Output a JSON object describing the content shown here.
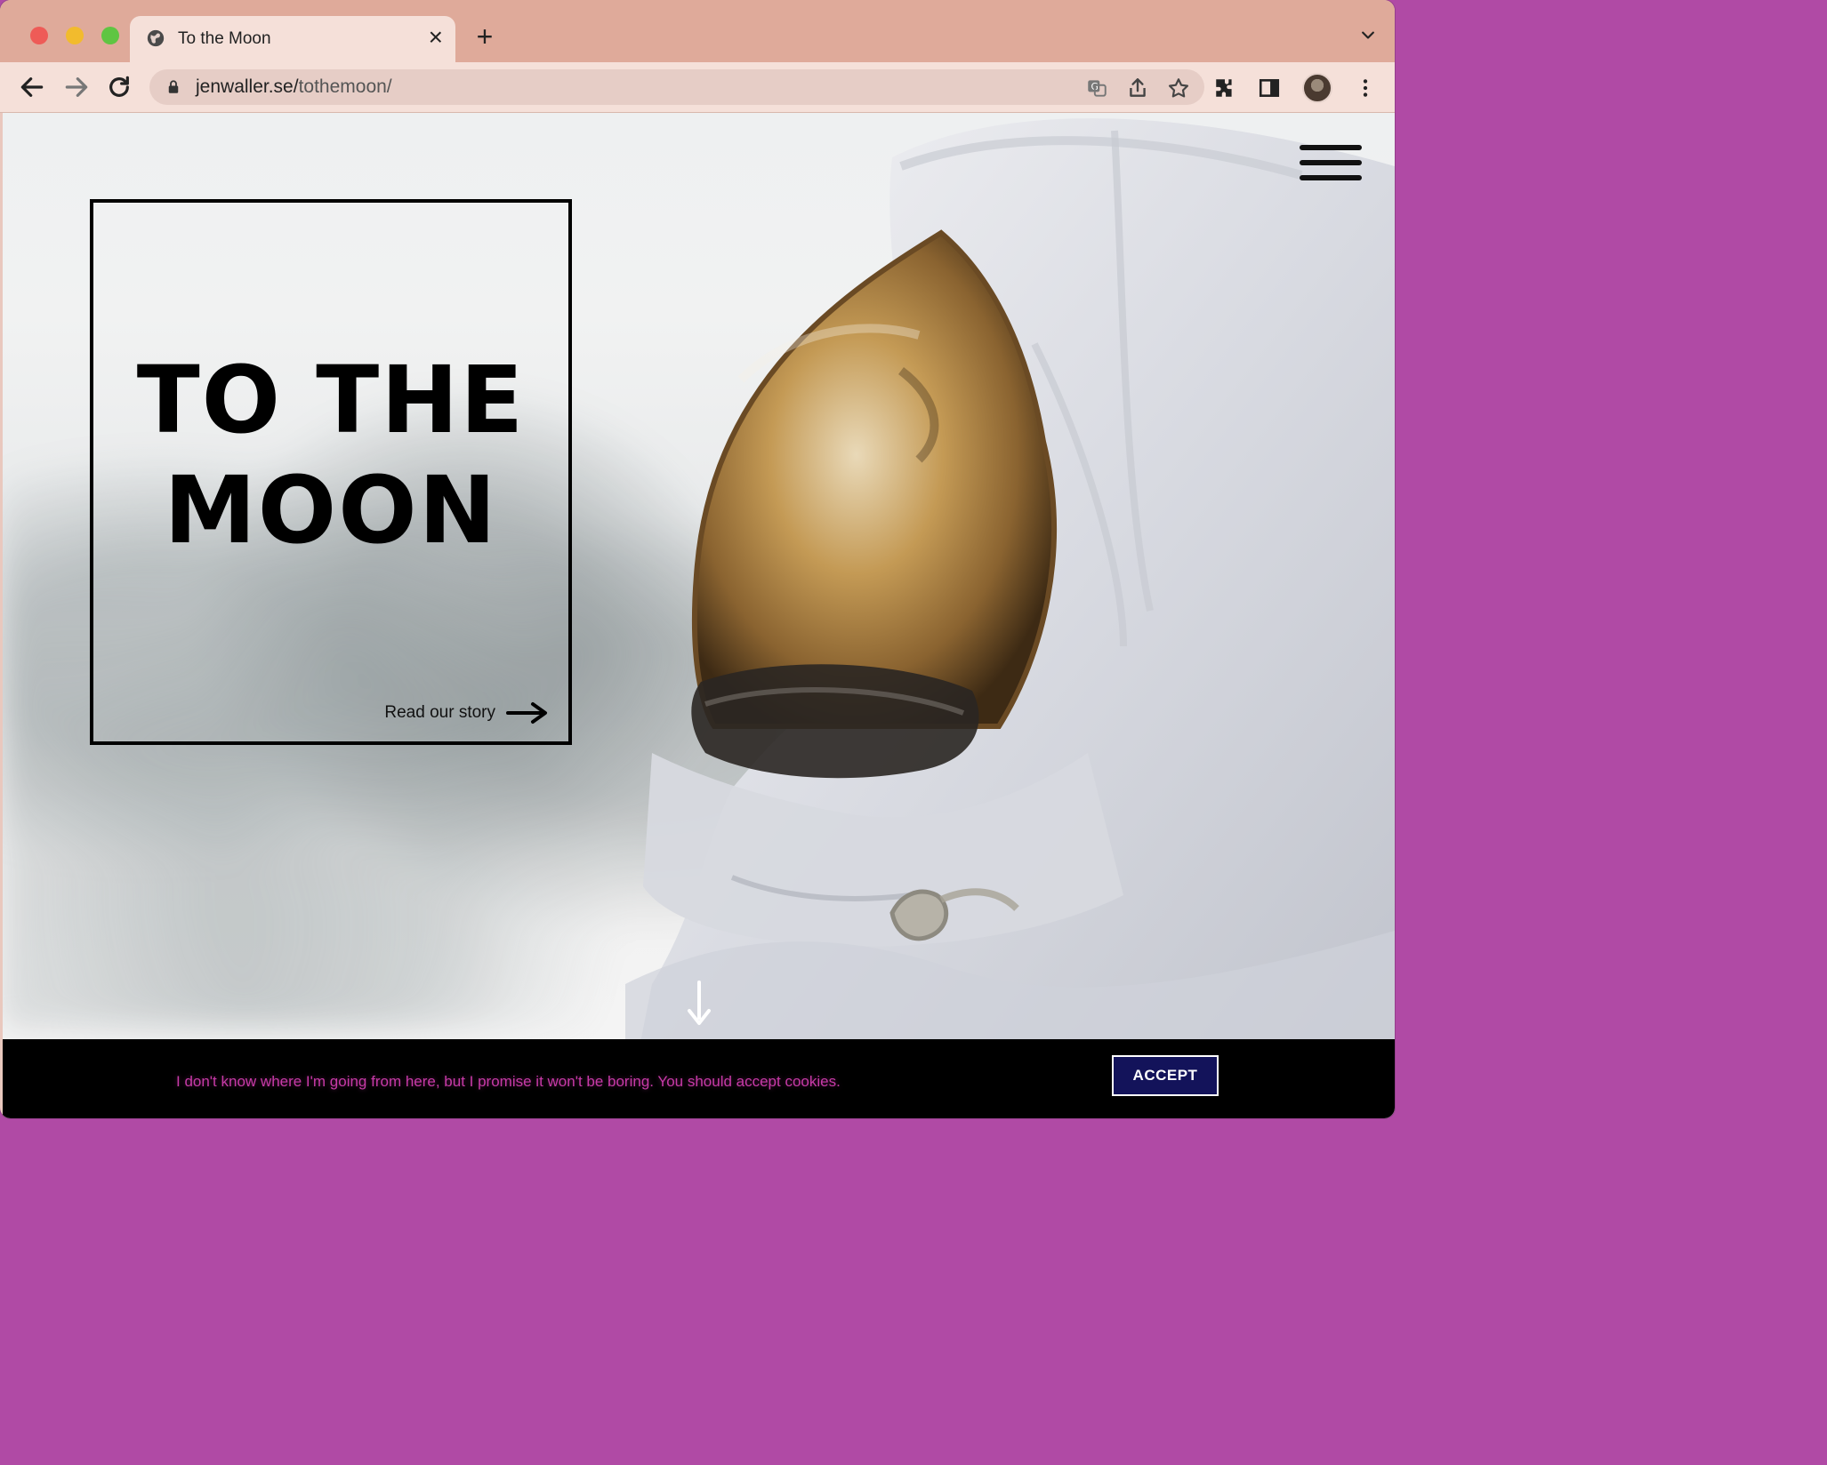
{
  "browser": {
    "tab_title": "To the Moon",
    "url_host": "jenwaller.se/",
    "url_path": "tothemoon/"
  },
  "page": {
    "hero_title_line1": "TO THE",
    "hero_title_line2": "MOON",
    "read_story_label": "Read our story",
    "cookie_message": "I don't know where I'm going from here, but I promise it won't be boring. You should accept cookies.",
    "accept_label": "ACCEPT"
  },
  "icons": {
    "tab_favicon": "globe-icon",
    "tab_close": "close-icon",
    "new_tab": "plus-icon",
    "tab_menu": "chevron-down-icon",
    "back": "back-arrow-icon",
    "forward": "forward-arrow-icon",
    "reload": "reload-icon",
    "lock": "lock-icon",
    "translate": "translate-icon",
    "share": "share-icon",
    "bookmark": "star-icon",
    "extensions": "puzzle-icon",
    "side_panel": "side-panel-icon",
    "profile": "avatar",
    "menu": "kebab-menu-icon",
    "site_menu": "hamburger-menu-icon",
    "read_story_arrow": "arrow-right-icon",
    "scroll_down": "arrow-down-icon"
  },
  "colors": {
    "tabbar": "#dfaa9a",
    "toolbar": "#f5e0d9",
    "cookie_text": "#c73aa7",
    "accept_bg": "#13135a"
  }
}
